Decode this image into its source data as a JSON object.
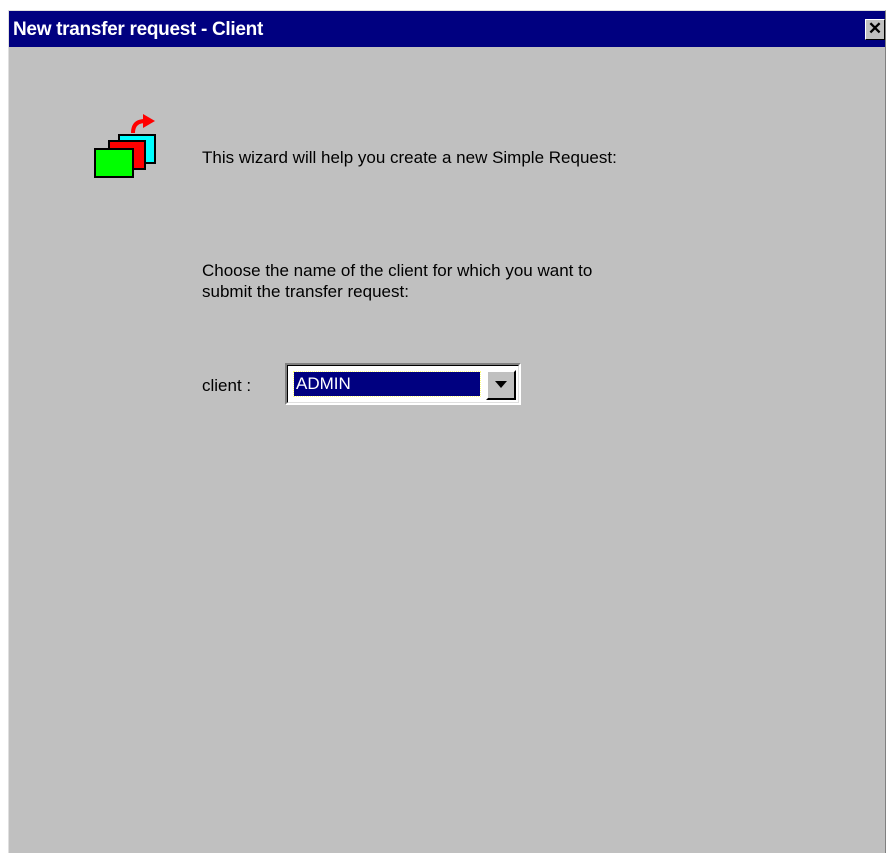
{
  "window": {
    "title": "New transfer request - Client",
    "close_label": "✕",
    "title_color": "#000080",
    "background_color": "#c0c0c0"
  },
  "wizard": {
    "icon": "stacked-cards-arrow-icon",
    "intro": "This wizard will help you create a new Simple Request:",
    "prompt_line1": "Choose the name of the client for which you want to",
    "prompt_line2": "submit the transfer request:"
  },
  "client_field": {
    "label": "client :",
    "selected_value": "ADMIN",
    "dropdown_icon": "chevron-down-icon"
  }
}
